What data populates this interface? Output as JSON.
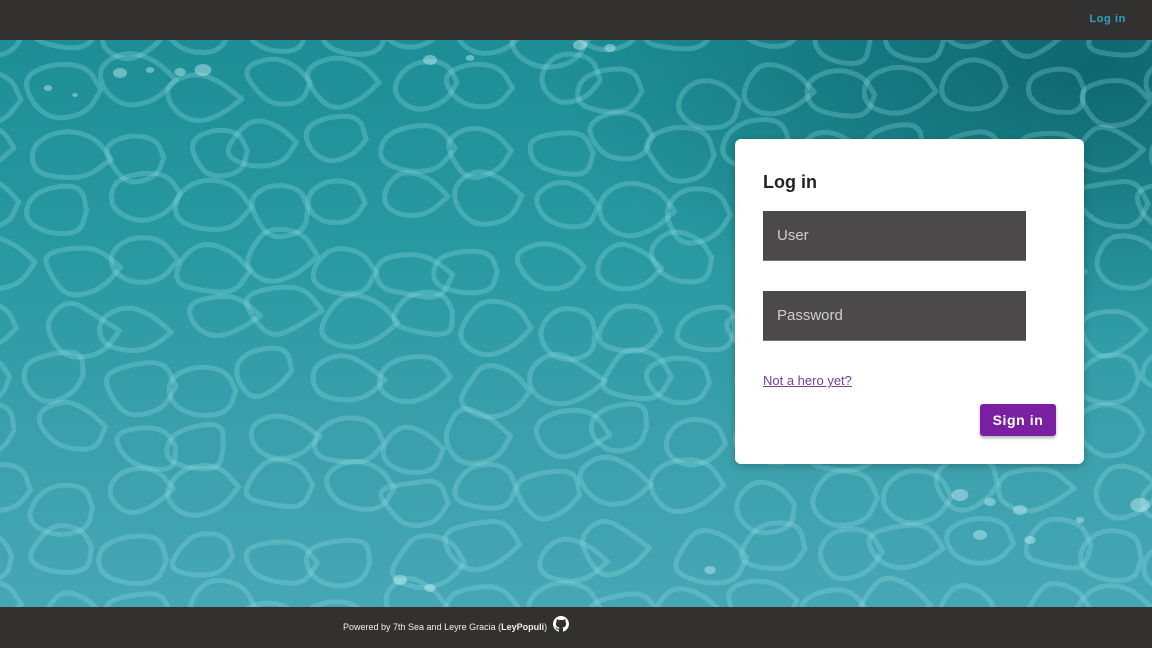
{
  "topbar": {
    "login_link": "Log in"
  },
  "login_card": {
    "title": "Log in",
    "user_placeholder": "User",
    "password_placeholder": "Password",
    "register_link": "Not a hero yet?",
    "signin_label": "Sign in"
  },
  "footer": {
    "prefix": "Powered by 7th Sea and Leyre Gracia (",
    "handle": "LeyPopuli",
    "suffix": ")",
    "icon": "github-icon"
  },
  "colors": {
    "bar": "#333030",
    "accent_link": "#2fa3c2",
    "button": "#7b1fa2",
    "field_bg": "#4b4949",
    "water": "#2a9aa2"
  }
}
